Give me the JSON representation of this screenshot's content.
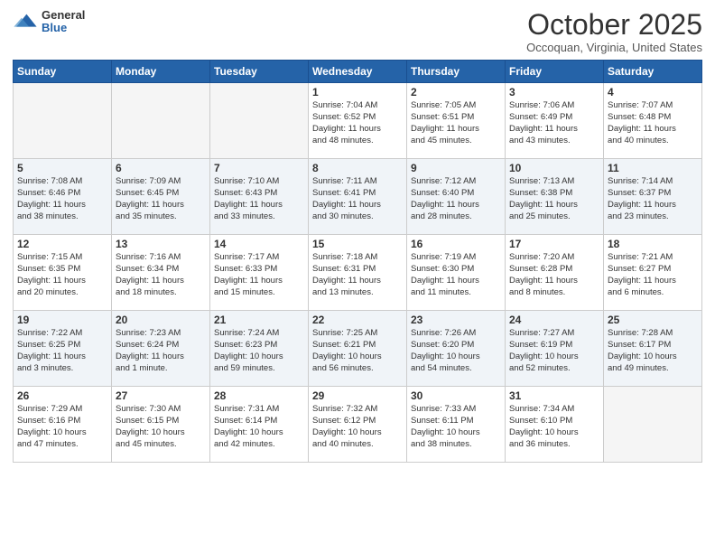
{
  "logo": {
    "general": "General",
    "blue": "Blue"
  },
  "title": "October 2025",
  "location": "Occoquan, Virginia, United States",
  "days_header": [
    "Sunday",
    "Monday",
    "Tuesday",
    "Wednesday",
    "Thursday",
    "Friday",
    "Saturday"
  ],
  "weeks": [
    [
      {
        "day": "",
        "info": ""
      },
      {
        "day": "",
        "info": ""
      },
      {
        "day": "",
        "info": ""
      },
      {
        "day": "1",
        "info": "Sunrise: 7:04 AM\nSunset: 6:52 PM\nDaylight: 11 hours\nand 48 minutes."
      },
      {
        "day": "2",
        "info": "Sunrise: 7:05 AM\nSunset: 6:51 PM\nDaylight: 11 hours\nand 45 minutes."
      },
      {
        "day": "3",
        "info": "Sunrise: 7:06 AM\nSunset: 6:49 PM\nDaylight: 11 hours\nand 43 minutes."
      },
      {
        "day": "4",
        "info": "Sunrise: 7:07 AM\nSunset: 6:48 PM\nDaylight: 11 hours\nand 40 minutes."
      }
    ],
    [
      {
        "day": "5",
        "info": "Sunrise: 7:08 AM\nSunset: 6:46 PM\nDaylight: 11 hours\nand 38 minutes."
      },
      {
        "day": "6",
        "info": "Sunrise: 7:09 AM\nSunset: 6:45 PM\nDaylight: 11 hours\nand 35 minutes."
      },
      {
        "day": "7",
        "info": "Sunrise: 7:10 AM\nSunset: 6:43 PM\nDaylight: 11 hours\nand 33 minutes."
      },
      {
        "day": "8",
        "info": "Sunrise: 7:11 AM\nSunset: 6:41 PM\nDaylight: 11 hours\nand 30 minutes."
      },
      {
        "day": "9",
        "info": "Sunrise: 7:12 AM\nSunset: 6:40 PM\nDaylight: 11 hours\nand 28 minutes."
      },
      {
        "day": "10",
        "info": "Sunrise: 7:13 AM\nSunset: 6:38 PM\nDaylight: 11 hours\nand 25 minutes."
      },
      {
        "day": "11",
        "info": "Sunrise: 7:14 AM\nSunset: 6:37 PM\nDaylight: 11 hours\nand 23 minutes."
      }
    ],
    [
      {
        "day": "12",
        "info": "Sunrise: 7:15 AM\nSunset: 6:35 PM\nDaylight: 11 hours\nand 20 minutes."
      },
      {
        "day": "13",
        "info": "Sunrise: 7:16 AM\nSunset: 6:34 PM\nDaylight: 11 hours\nand 18 minutes."
      },
      {
        "day": "14",
        "info": "Sunrise: 7:17 AM\nSunset: 6:33 PM\nDaylight: 11 hours\nand 15 minutes."
      },
      {
        "day": "15",
        "info": "Sunrise: 7:18 AM\nSunset: 6:31 PM\nDaylight: 11 hours\nand 13 minutes."
      },
      {
        "day": "16",
        "info": "Sunrise: 7:19 AM\nSunset: 6:30 PM\nDaylight: 11 hours\nand 11 minutes."
      },
      {
        "day": "17",
        "info": "Sunrise: 7:20 AM\nSunset: 6:28 PM\nDaylight: 11 hours\nand 8 minutes."
      },
      {
        "day": "18",
        "info": "Sunrise: 7:21 AM\nSunset: 6:27 PM\nDaylight: 11 hours\nand 6 minutes."
      }
    ],
    [
      {
        "day": "19",
        "info": "Sunrise: 7:22 AM\nSunset: 6:25 PM\nDaylight: 11 hours\nand 3 minutes."
      },
      {
        "day": "20",
        "info": "Sunrise: 7:23 AM\nSunset: 6:24 PM\nDaylight: 11 hours\nand 1 minute."
      },
      {
        "day": "21",
        "info": "Sunrise: 7:24 AM\nSunset: 6:23 PM\nDaylight: 10 hours\nand 59 minutes."
      },
      {
        "day": "22",
        "info": "Sunrise: 7:25 AM\nSunset: 6:21 PM\nDaylight: 10 hours\nand 56 minutes."
      },
      {
        "day": "23",
        "info": "Sunrise: 7:26 AM\nSunset: 6:20 PM\nDaylight: 10 hours\nand 54 minutes."
      },
      {
        "day": "24",
        "info": "Sunrise: 7:27 AM\nSunset: 6:19 PM\nDaylight: 10 hours\nand 52 minutes."
      },
      {
        "day": "25",
        "info": "Sunrise: 7:28 AM\nSunset: 6:17 PM\nDaylight: 10 hours\nand 49 minutes."
      }
    ],
    [
      {
        "day": "26",
        "info": "Sunrise: 7:29 AM\nSunset: 6:16 PM\nDaylight: 10 hours\nand 47 minutes."
      },
      {
        "day": "27",
        "info": "Sunrise: 7:30 AM\nSunset: 6:15 PM\nDaylight: 10 hours\nand 45 minutes."
      },
      {
        "day": "28",
        "info": "Sunrise: 7:31 AM\nSunset: 6:14 PM\nDaylight: 10 hours\nand 42 minutes."
      },
      {
        "day": "29",
        "info": "Sunrise: 7:32 AM\nSunset: 6:12 PM\nDaylight: 10 hours\nand 40 minutes."
      },
      {
        "day": "30",
        "info": "Sunrise: 7:33 AM\nSunset: 6:11 PM\nDaylight: 10 hours\nand 38 minutes."
      },
      {
        "day": "31",
        "info": "Sunrise: 7:34 AM\nSunset: 6:10 PM\nDaylight: 10 hours\nand 36 minutes."
      },
      {
        "day": "",
        "info": ""
      }
    ]
  ]
}
